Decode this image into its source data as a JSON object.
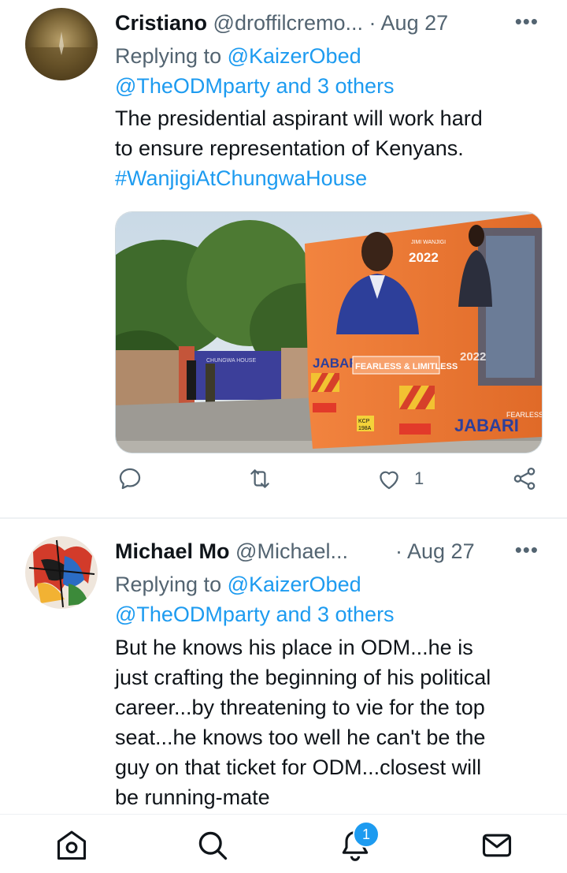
{
  "tweets": [
    {
      "name": "Cristiano",
      "handle": "@droffilcremo...",
      "separator": "·",
      "date": "Aug 27",
      "more_label": "•••",
      "replying_prefix": "Replying to",
      "replying_to_1": "@KaizerObed",
      "replying_to_2": "@TheODMparty and 3 others",
      "text_line1": "The presidential aspirant will work hard",
      "text_line2": "to ensure representation of Kenyans.",
      "hashtag": "#WanjigiAtChungwaHouse",
      "media": {
        "banner_year": "2022",
        "banner_top": "JIMI WANJIGI",
        "gate_sign": "CHUNGWA HOUSE",
        "slogan_brand": "JABARI",
        "slogan": "FEARLESS & LIMITLESS",
        "side_year": "2022",
        "plate_line1": "KCP",
        "plate_line2": "198A",
        "side_brand": "JABARI",
        "side_slogan": "FEARLESS & L"
      },
      "like_count": "1"
    },
    {
      "name": "Michael Mo",
      "handle": "@Michael...",
      "separator": "·",
      "date": "Aug 27",
      "more_label": "•••",
      "replying_prefix": "Replying to",
      "replying_to_1": "@KaizerObed",
      "replying_to_2": "@TheODMparty and 3 others",
      "text_lines": [
        "But he knows his place in ODM...he is",
        "just crafting the beginning of his political",
        "career...by threatening to vie for the top",
        "seat...he knows too well he can't be the",
        "guy on that ticket for ODM...closest will",
        "be running-mate"
      ]
    }
  ],
  "nav": {
    "notifications_badge": "1",
    "icons": [
      "home-icon",
      "search-icon",
      "bell-icon",
      "mail-icon"
    ]
  },
  "colors": {
    "link": "#1d9bf0",
    "secondary_text": "#536471",
    "bus_orange": "#f07a36"
  }
}
